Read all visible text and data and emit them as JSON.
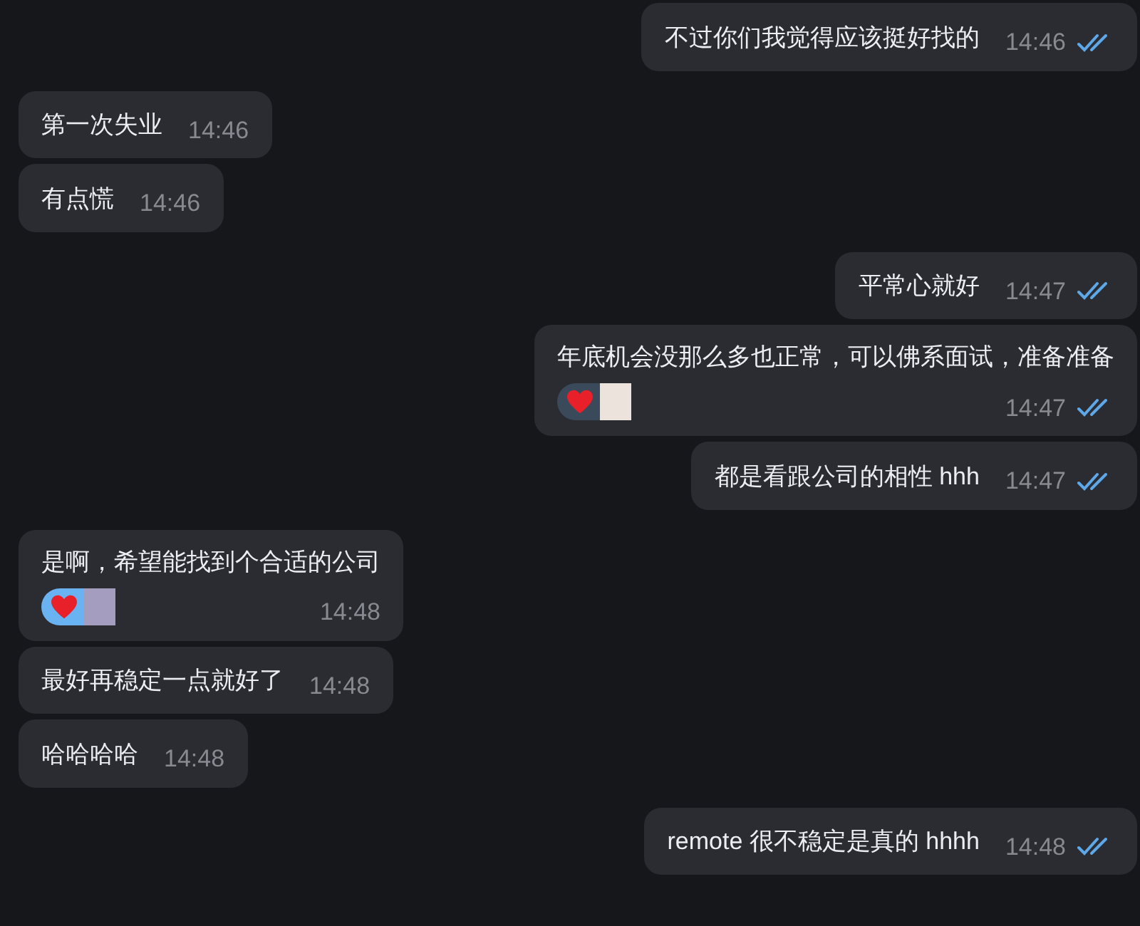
{
  "messages": [
    {
      "kind": "outgoing",
      "text": "不过你们我觉得应该挺好找的",
      "time": "14:46",
      "read": true
    },
    {
      "kind": "incoming",
      "text": "第一次失业",
      "time": "14:46"
    },
    {
      "kind": "incoming",
      "text": "有点慌",
      "time": "14:46"
    },
    {
      "kind": "outgoing",
      "text": "平常心就好",
      "time": "14:47",
      "read": true
    },
    {
      "kind": "outgoing",
      "text": "年底机会没那么多也正常，可以佛系面试，准备准备",
      "time": "14:47",
      "read": true,
      "reaction": {
        "selected": false
      }
    },
    {
      "kind": "outgoing",
      "text": "都是看跟公司的相性 hhh",
      "time": "14:47",
      "read": true
    },
    {
      "kind": "incoming",
      "text": "是啊，希望能找到个合适的公司",
      "time": "14:48",
      "reaction": {
        "selected": true
      }
    },
    {
      "kind": "incoming",
      "text": "最好再稳定一点就好了",
      "time": "14:48"
    },
    {
      "kind": "incoming",
      "text": "哈哈哈哈",
      "time": "14:48"
    },
    {
      "kind": "outgoing",
      "text": "remote 很不稳定是真的 hhhh",
      "time": "14:48",
      "read": true
    }
  ]
}
